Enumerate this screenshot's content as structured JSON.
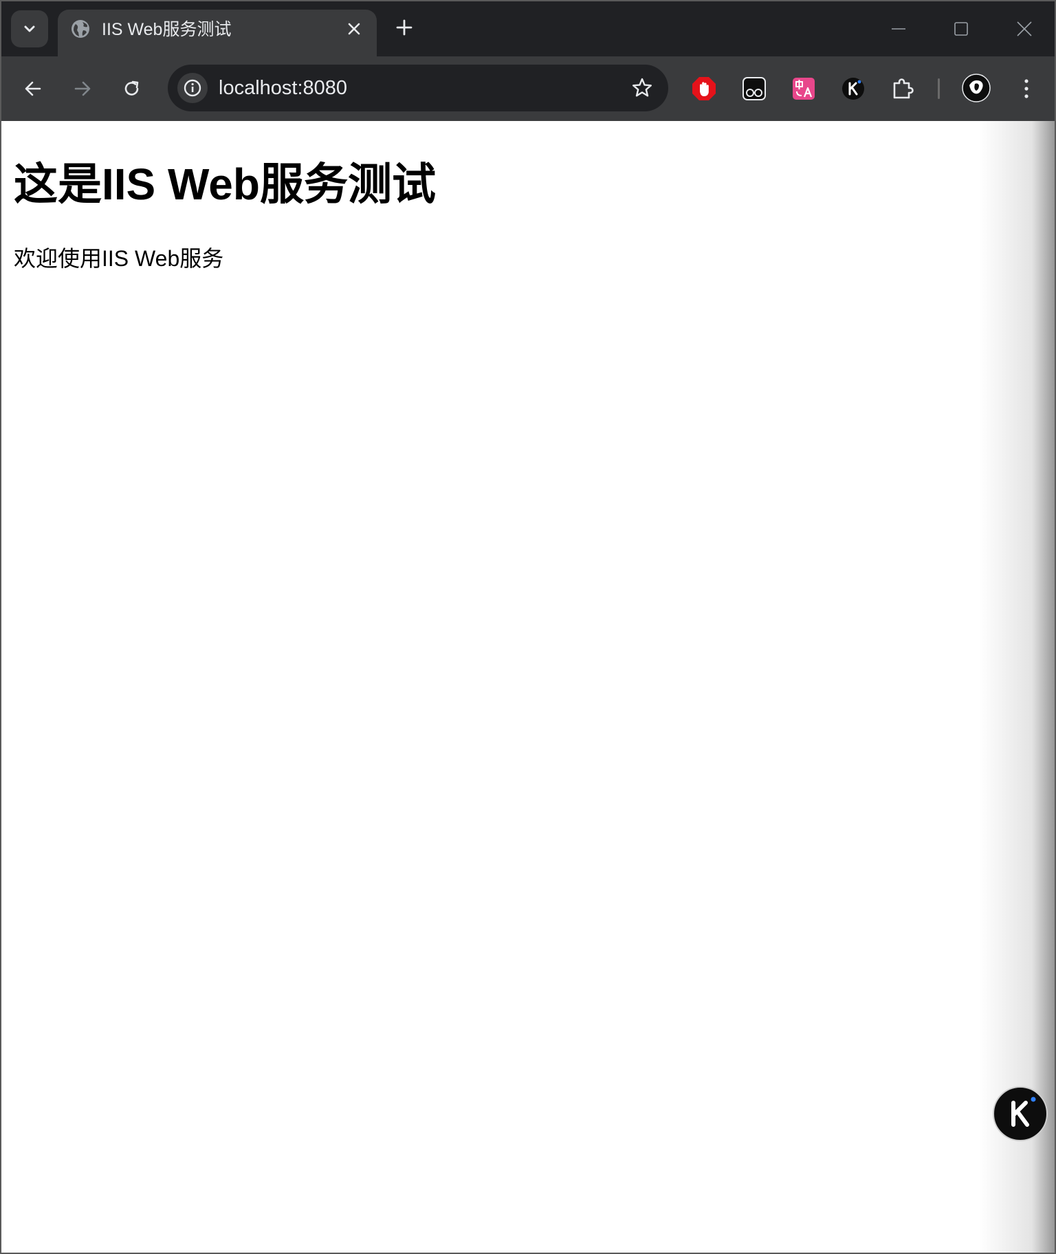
{
  "browser": {
    "tab": {
      "title": "IIS Web服务测试"
    },
    "address_bar": {
      "url": "localhost:8080"
    },
    "icons": {
      "tab_search": "chevron-down-icon",
      "favicon": "globe-icon",
      "close_tab": "close-icon",
      "new_tab": "plus-icon",
      "back": "arrow-left-icon",
      "forward": "arrow-right-icon",
      "reload": "reload-icon",
      "site_info": "info-icon",
      "bookmark": "star-icon",
      "extensions": "puzzle-icon",
      "menu": "more-vertical-icon"
    },
    "colors": {
      "adblock": "#e5121a",
      "translate": "#e8478b",
      "tab_strip": "#202124",
      "toolbar": "#3a3b3d"
    }
  },
  "page": {
    "heading": "这是IIS Web服务测试",
    "paragraph": "欢迎使用IIS Web服务"
  }
}
